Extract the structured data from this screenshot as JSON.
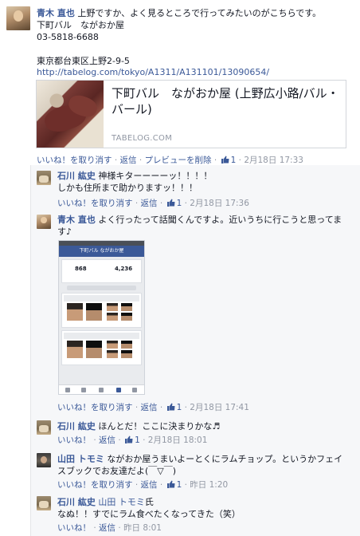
{
  "post": {
    "author": "青木 直也",
    "text": "上野ですか、よく見るところで行ってみたいのがこちらです。",
    "shop_line": "下町バル　ながおか屋",
    "phone": "03-5818-6688",
    "address": "東京都台東区上野2-9-5",
    "url": "http://tabelog.com/tokyo/A1311/A131101/13090654/",
    "card": {
      "title_line1": "下町バル　ながおか屋 (上野広小路/バル・",
      "title_line2": "バール)",
      "domain": "TABELOG.COM"
    },
    "actions": {
      "unlike": "いいね！を取り消す",
      "reply": "返信",
      "remove_preview": "プレビューを削除",
      "like_count": "1",
      "time": "2月18日 17:33"
    }
  },
  "separator": "·",
  "replies": [
    {
      "author": "石川 紘史",
      "lines": [
        "神様キターーーーッ！！！！",
        "しかも住所まで助かりますッ！！！"
      ],
      "actions": {
        "unlike": "いいね！を取り消す",
        "reply": "返信",
        "like_count": "1",
        "time": "2月18日 17:36"
      }
    },
    {
      "author": "青木 直也",
      "lines": [
        "よく行ったって話聞くんですよ。近いうちに行こうと思ってま",
        "す♪"
      ],
      "actions": {
        "unlike": "いいね！を取り消す",
        "reply": "返信",
        "like_count": "1",
        "time": "2月18日 17:41"
      }
    },
    {
      "author": "石川 紘史",
      "lines": [
        "ほんとだ！ここに決まりかな♬"
      ],
      "actions": {
        "like": "いいね！",
        "reply": "返信",
        "like_count": "1",
        "time": "2月18日 18:01"
      }
    },
    {
      "author": "山田 トモミ",
      "lines": [
        "ながおか屋うまいよーとくにラムチョップ。というかフェイ",
        "スブックでお友達だよ(￣▽￣)"
      ],
      "actions": {
        "unlike": "いいね！を取り消す",
        "reply": "返信",
        "like_count": "1",
        "time": "昨日 1:20"
      }
    },
    {
      "author": "石川 紘史",
      "mention": "山田 トモミ",
      "mention_suffix": "氏",
      "lines": [
        "なぬ！！すでにラム食べたくなってきた（笑）"
      ],
      "actions": {
        "like": "いいね！",
        "reply": "返信",
        "time": "昨日 8:01"
      }
    }
  ],
  "screenshot": {
    "title": "下町バル ながおか屋",
    "stat1_num": "868",
    "stat2_num": "4,236"
  },
  "colors": {
    "link": "#3b5998",
    "muted": "#9197a3",
    "reply_bg": "#f6f7f9"
  }
}
